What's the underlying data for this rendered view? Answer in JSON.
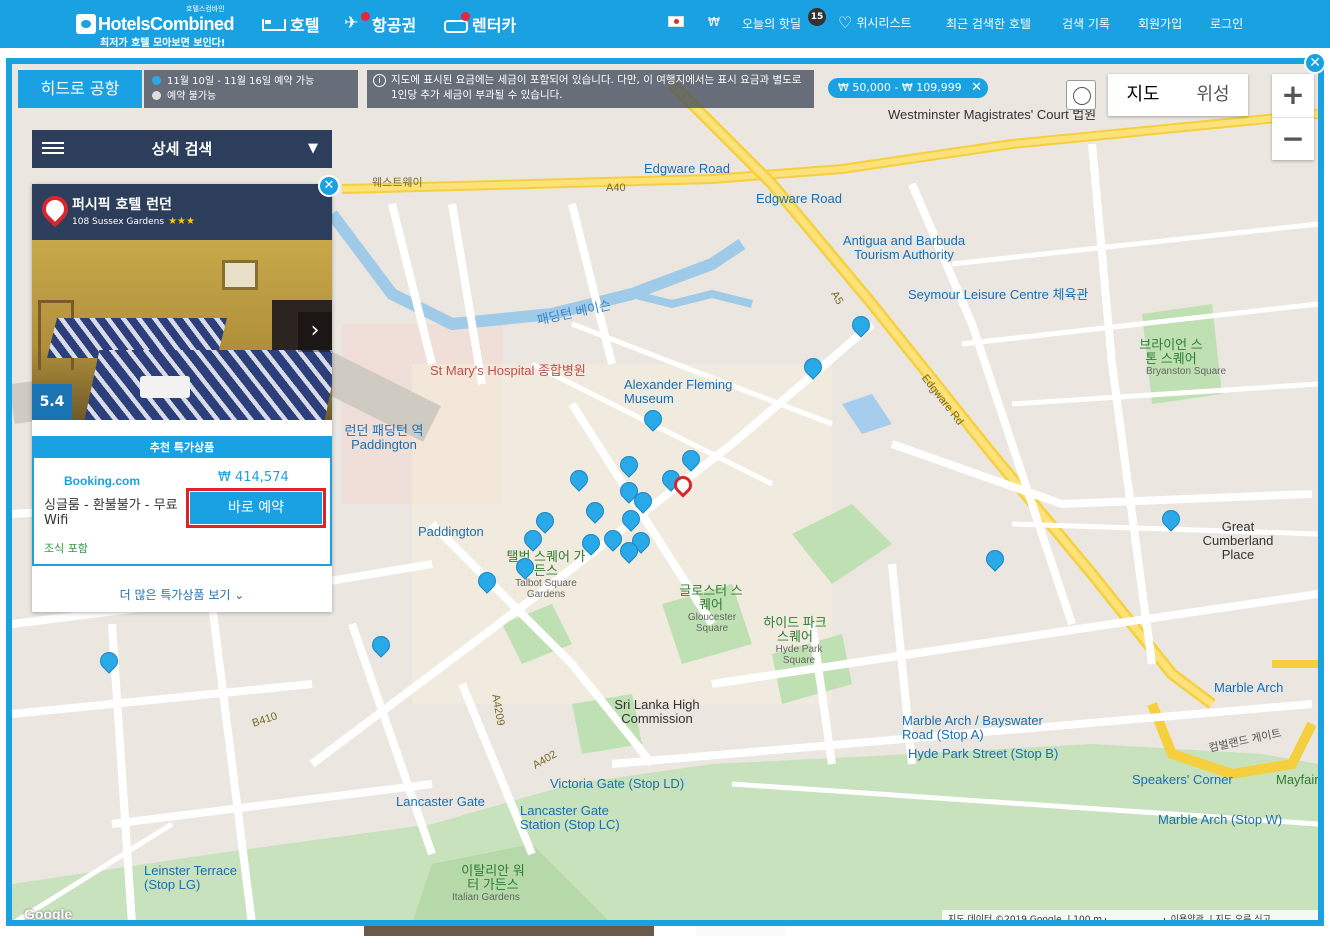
{
  "header": {
    "logo_sub": "호텔스컴바인",
    "logo_name": "HotelsCombined",
    "logo_tagline": "최저가 호텔 모아보면 보인다!",
    "nav": [
      {
        "label": "호텔",
        "icon": "bed-icon"
      },
      {
        "label": "항공권",
        "icon": "plane-icon"
      },
      {
        "label": "렌터카",
        "icon": "car-icon"
      }
    ],
    "currency": "₩",
    "today_deals": "오늘의 핫딜",
    "today_deals_count": "15",
    "wishlist": "위시리스트",
    "recent_hotels": "최근 검색한 호텔",
    "search_history": "검색 기록",
    "signup": "회원가입",
    "login": "로그인"
  },
  "map_header": {
    "airport": "히드로 공항",
    "avail_available": "11월 10일 - 11월 16일 예약 가능",
    "avail_unavailable": "예약 불가능",
    "tax_note": "지도에 표시된 요금에는 세금이 포함되어 있습니다. 다만, 이 여행지에서는 표시 요금과 별도로 1인당 추가 세금이 부과될 수 있습니다.",
    "price_filter": "₩ 50,000 - ₩ 109,999",
    "map_type_map": "지도",
    "map_type_satellite": "위성"
  },
  "search": {
    "label": "상세 검색"
  },
  "hotel_card": {
    "name": "퍼시픽 호텔 런던",
    "address": "108 Sussex Gardens",
    "stars": "★★★",
    "score": "5.4",
    "deal_title": "추천 특가상품",
    "provider": "Booking.com",
    "price": "₩ 414,574",
    "room": "싱글룸 - 환불불가 - 무료 Wifi",
    "meal": "조식 포함",
    "book_label": "바로 예약",
    "more_deals": "더 많은 특가상품 보기"
  },
  "map_labels": [
    "Westminster Magistrates' Court 법원",
    "Edgware Road",
    "Edgware Road",
    "Antigua and Barbuda Tourism Authority",
    "Seymour Leisure Centre 체육관",
    "브라이언 스톤 스퀘어",
    "Bryanston Square",
    "패딩턴 베이슨",
    "St Mary's Hospital 종합병원",
    "Alexander Fleming Museum",
    "런던 패딩턴 역 Paddington",
    "Paddington",
    "탤벗 스퀘어 가든스",
    "Talbot Square Gardens",
    "글로스터 스퀘어",
    "Gloucester Square",
    "하이드 파크 스퀘어",
    "Hyde Park Square",
    "Great Cumberland Place",
    "Sri Lanka High Commission",
    "Marble Arch",
    "Marble Arch / Bayswater Road (Stop A)",
    "Hyde Park Street (Stop B)",
    "Victoria Gate (Stop LD)",
    "Lancaster Gate",
    "Lancaster Gate Station (Stop LC)",
    "Speakers' Corner",
    "Marble Arch (Stop W)",
    "Leinster Terrace (Stop LG)",
    "이탈리안 워터 가든스",
    "Italian Gardens",
    "Edgware Rd",
    "웨스트웨이",
    "A40",
    "A5",
    "B410",
    "A402",
    "A4209",
    "Mayfair",
    "컴벌랜드 게이트"
  ],
  "attribution": {
    "data": "지도 데이터 ©2019 Google",
    "scale": "100 m",
    "terms": "이용약관",
    "report": "지도 오류 신고"
  },
  "colors": {
    "brand": "#1aa1e1",
    "panel": "#2c3e5c",
    "highlight": "#e0232a",
    "pin": "#29a9e8"
  }
}
